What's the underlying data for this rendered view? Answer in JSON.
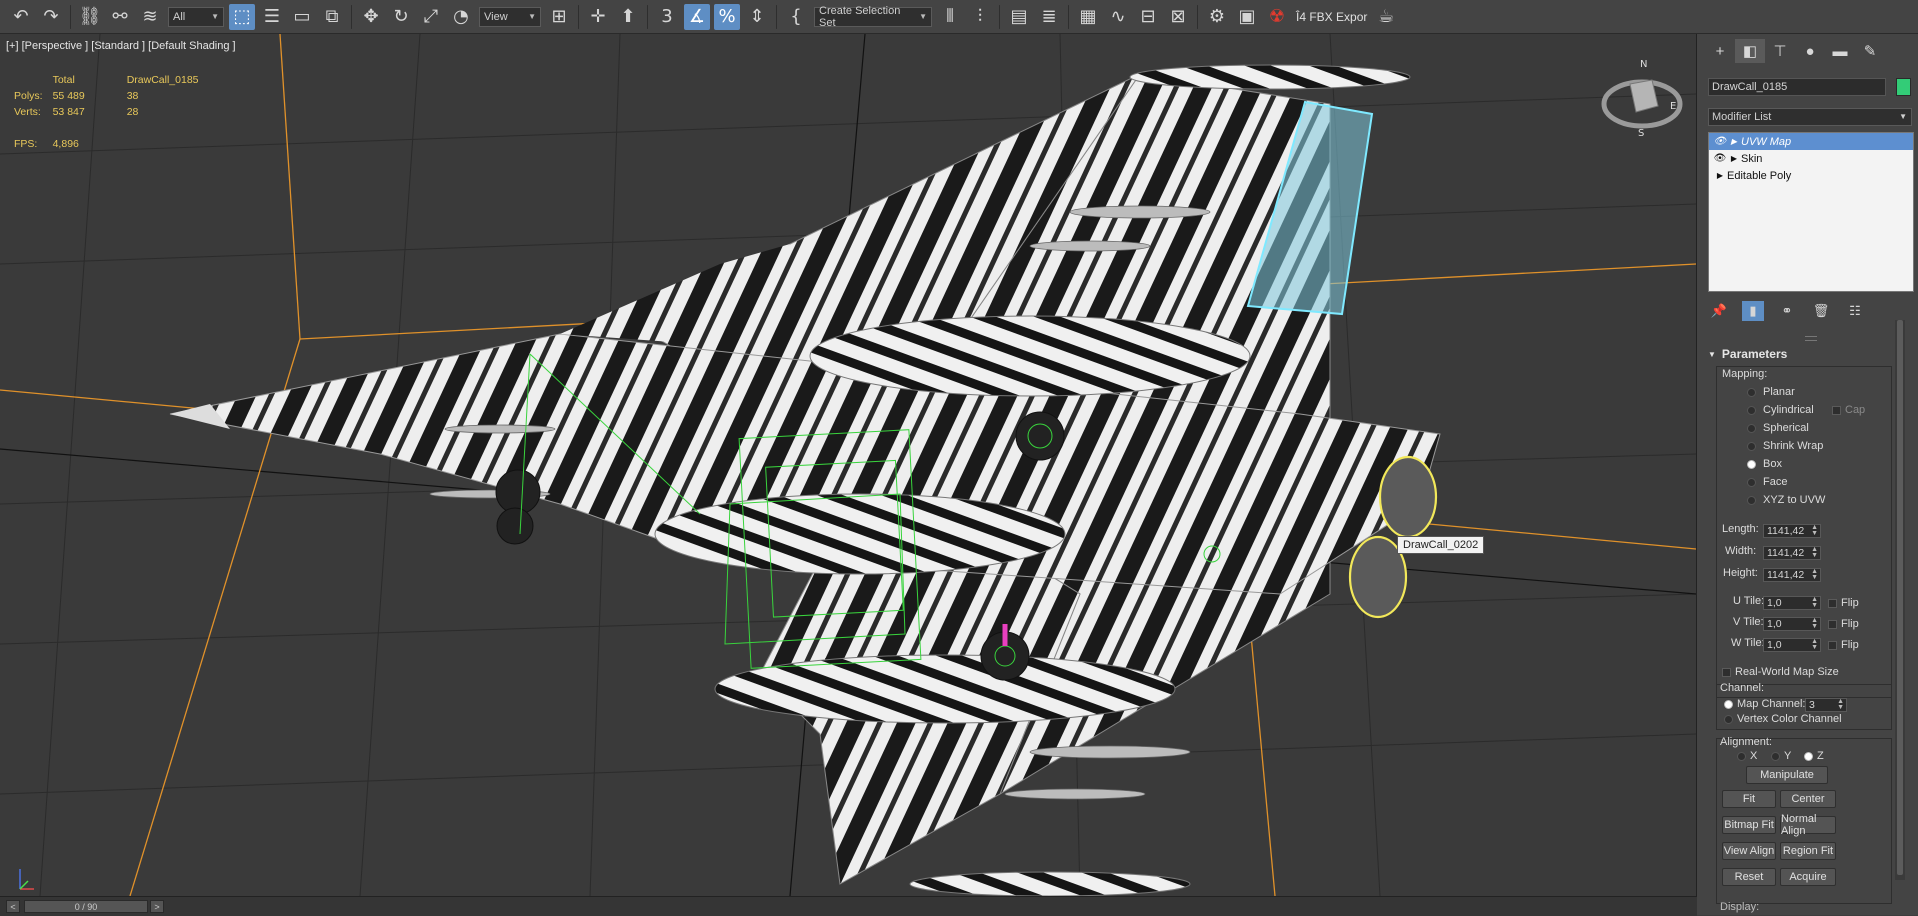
{
  "toolbar": {
    "selection_filter": "All",
    "coordinate_system": "View",
    "named_selection_set": "Create Selection Set",
    "fbx_export_label": "Î4 FBX Expor"
  },
  "viewport": {
    "label": "[+] [Perspective ] [Standard ] [Default Shading ]",
    "stats": {
      "col_total": "Total",
      "col_object": "DrawCall_0185",
      "polys_label": "Polys:",
      "polys_total": "55 489",
      "polys_object": "38",
      "verts_label": "Verts:",
      "verts_total": "53 847",
      "verts_object": "28",
      "fps_label": "FPS:",
      "fps_value": "4,896"
    },
    "tooltip": "DrawCall_0202"
  },
  "panel": {
    "object_name": "DrawCall_0185",
    "modifier_list": "Modifier List",
    "stack": [
      "UVW Map",
      "Skin",
      "Editable Poly"
    ],
    "parameters_title": "Parameters",
    "mapping_title": "Mapping:",
    "mapping_options": [
      "Planar",
      "Cylindrical",
      "Spherical",
      "Shrink Wrap",
      "Box",
      "Face",
      "XYZ to UVW"
    ],
    "mapping_selected": "Box",
    "cap_label": "Cap",
    "length_label": "Length:",
    "length_value": "1141,42",
    "width_label": "Width:",
    "width_value": "1141,42",
    "height_label": "Height:",
    "height_value": "1141,42",
    "utile_label": "U Tile:",
    "utile_value": "1,0",
    "vtile_label": "V Tile:",
    "vtile_value": "1,0",
    "wtile_label": "W Tile:",
    "wtile_value": "1,0",
    "flip_label": "Flip",
    "real_world_label": "Real-World Map Size",
    "channel_title": "Channel:",
    "map_channel_label": "Map Channel:",
    "map_channel_value": "3",
    "vertex_color_label": "Vertex Color Channel",
    "alignment_title": "Alignment:",
    "axis_x": "X",
    "axis_y": "Y",
    "axis_z": "Z",
    "manipulate": "Manipulate",
    "fit": "Fit",
    "center": "Center",
    "bitmap_fit": "Bitmap Fit",
    "normal_align": "Normal Align",
    "view_align": "View Align",
    "region_fit": "Region Fit",
    "reset": "Reset",
    "acquire": "Acquire",
    "display_title": "Display:"
  },
  "timeline": {
    "frame": "0 / 90",
    "prev": "<",
    "next": ">"
  },
  "colors": {
    "accent": "#5e8ec4",
    "stats_text": "#e8c85a",
    "object_color": "#33cc77",
    "selection_cyan": "#7fe9ff",
    "selection_yellow": "#f2e85a"
  }
}
